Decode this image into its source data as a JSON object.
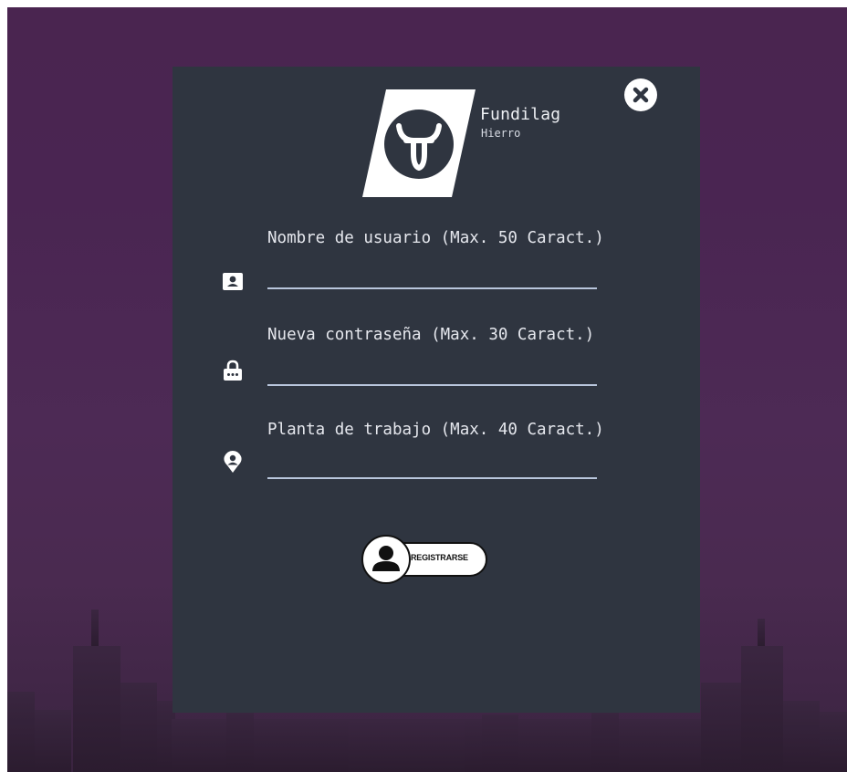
{
  "brand": {
    "name": "Fundilag",
    "subtitle": "Hierro"
  },
  "form": {
    "fields": [
      {
        "label": "Nombre de usuario (Max. 50 Caract.)",
        "value": "",
        "icon": "contact-card-icon"
      },
      {
        "label": "Nueva contraseña (Max. 30 Caract.)",
        "value": "",
        "icon": "lock-icon"
      },
      {
        "label": "Planta de trabajo (Max. 40 Caract.)",
        "value": "",
        "icon": "location-pin-icon"
      }
    ],
    "submit_label": "REGISTRARSE",
    "close_icon": "close-icon"
  },
  "colors": {
    "panel": "#2f3540",
    "background": "#4a2550",
    "input_underline": "#b9c6dc",
    "text": "#e6e8ee"
  }
}
